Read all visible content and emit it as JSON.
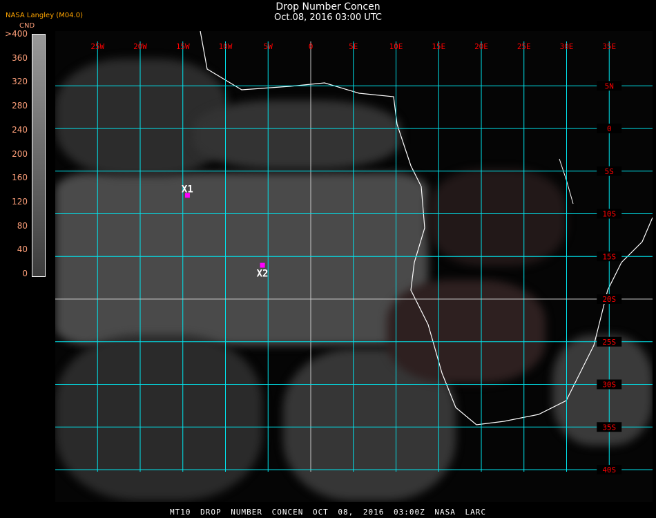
{
  "header": {
    "title": "Drop Number Concen",
    "subtitle": "Oct.08, 2016 03:00 UTC"
  },
  "legend": {
    "brand": "NASA Langley (M04.0)",
    "units": "CND",
    "ticks": [
      ">400",
      "360",
      "320",
      "280",
      "240",
      "200",
      "160",
      "120",
      "80",
      "40",
      "0"
    ]
  },
  "map": {
    "lon_labels": [
      {
        "lon": -25,
        "label": "25W"
      },
      {
        "lon": -20,
        "label": "20W"
      },
      {
        "lon": -15,
        "label": "15W"
      },
      {
        "lon": -10,
        "label": "10W"
      },
      {
        "lon": -5,
        "label": "5W"
      },
      {
        "lon": 0,
        "label": "0"
      },
      {
        "lon": 5,
        "label": "5E"
      },
      {
        "lon": 10,
        "label": "10E"
      },
      {
        "lon": 15,
        "label": "15E"
      },
      {
        "lon": 20,
        "label": "20E"
      },
      {
        "lon": 25,
        "label": "25E"
      },
      {
        "lon": 30,
        "label": "30E"
      },
      {
        "lon": 35,
        "label": "35E"
      }
    ],
    "lat_labels": [
      {
        "lat": 5,
        "label": "5N"
      },
      {
        "lat": 0,
        "label": "0"
      },
      {
        "lat": -5,
        "label": "5S"
      },
      {
        "lat": -10,
        "label": "10S"
      },
      {
        "lat": -15,
        "label": "15S"
      },
      {
        "lat": -20,
        "label": "20S"
      },
      {
        "lat": -25,
        "label": "25S"
      },
      {
        "lat": -30,
        "label": "30S"
      },
      {
        "lat": -35,
        "label": "35S"
      },
      {
        "lat": -40,
        "label": "40S"
      }
    ],
    "markers": [
      {
        "label": "X1",
        "lon": -14.5,
        "lat": -7.8
      },
      {
        "label": "X2",
        "lon": -5.7,
        "lat": -16.0
      }
    ],
    "colors": {
      "grid": "#00e5ee",
      "grid_alt": "#c8c8c8",
      "label": "#ff0000",
      "marker": "#ff00ff",
      "coast": "#ffffff"
    }
  },
  "footer": {
    "text": "MT10  DROP NUMBER CONCEN   OCT 08, 2016 03:00Z   NASA LARC"
  }
}
